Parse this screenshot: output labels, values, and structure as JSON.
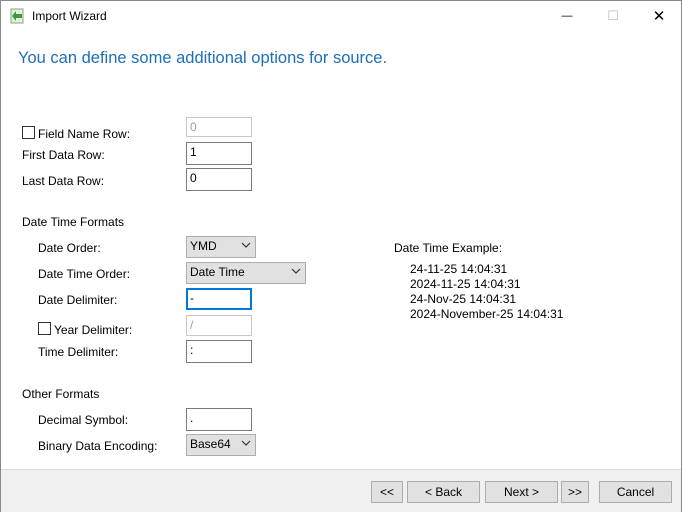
{
  "window": {
    "title": "Import Wizard",
    "minimize_glyph": "—",
    "maximize_glyph": "☐",
    "close_glyph": "✕"
  },
  "heading": "You can define some additional options for source.",
  "rows": {
    "field_name_row_label": "Field Name Row:",
    "field_name_row_checked": false,
    "field_name_row_value": "0",
    "first_data_row_label": "First Data Row:",
    "first_data_row_value": "1",
    "last_data_row_label": "Last Data Row:",
    "last_data_row_value": "0"
  },
  "date_time": {
    "section_label": "Date Time Formats",
    "date_order_label": "Date Order:",
    "date_order_value": "YMD",
    "date_time_order_label": "Date Time Order:",
    "date_time_order_value": "Date Time",
    "date_delimiter_label": "Date Delimiter:",
    "date_delimiter_value": "-",
    "year_delimiter_label": "Year Delimiter:",
    "year_delimiter_checked": false,
    "year_delimiter_value": "/",
    "time_delimiter_label": "Time Delimiter:",
    "time_delimiter_value": ":"
  },
  "example": {
    "label": "Date Time Example:",
    "lines": [
      "24-11-25 14:04:31",
      "2024-11-25 14:04:31",
      "24-Nov-25 14:04:31",
      "2024-November-25 14:04:31"
    ]
  },
  "other": {
    "section_label": "Other Formats",
    "decimal_symbol_label": "Decimal Symbol:",
    "decimal_symbol_value": ".",
    "binary_encoding_label": "Binary Data Encoding:",
    "binary_encoding_value": "Base64"
  },
  "footer": {
    "first_label": "<<",
    "back_label": "< Back",
    "next_label": "Next >",
    "last_label": ">>",
    "cancel_label": "Cancel"
  },
  "colors": {
    "heading": "#1d6fb8",
    "focus_border": "#0078d7",
    "footer_bg": "#f0f0f0",
    "button_bg": "#e1e1e1"
  },
  "icons": {
    "app": "import-arrow-icon",
    "dropdown": "chevron-down-icon"
  }
}
